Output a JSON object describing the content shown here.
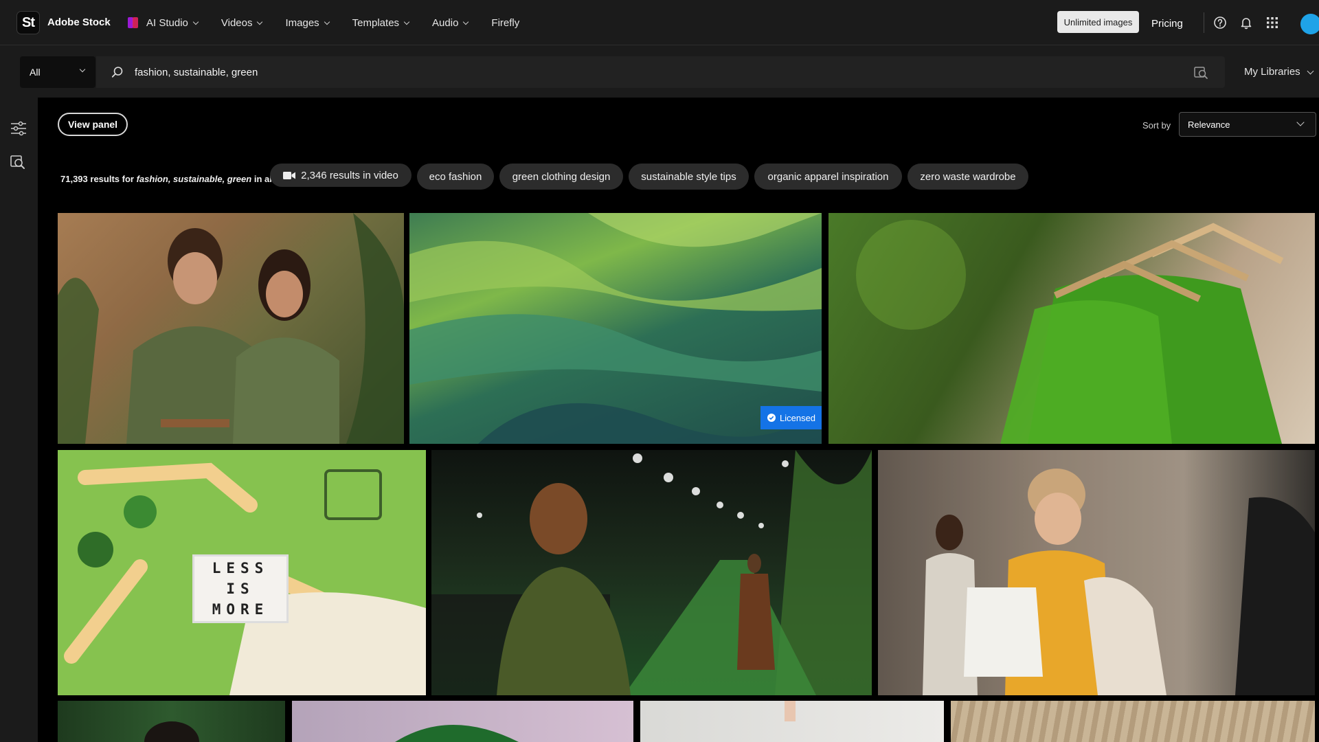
{
  "app": {
    "logo_text": "St",
    "brand": "Adobe Stock"
  },
  "nav": {
    "items": [
      {
        "label": "AI Studio",
        "has_menu": true
      },
      {
        "label": "Videos",
        "has_menu": true
      },
      {
        "label": "Images",
        "has_menu": true
      },
      {
        "label": "Templates",
        "has_menu": true
      },
      {
        "label": "Audio",
        "has_menu": true
      },
      {
        "label": "Firefly",
        "has_menu": false
      }
    ],
    "unlimited_button": "Unlimited images",
    "pricing": "Pricing",
    "icons": [
      "help-icon",
      "bell-icon",
      "apps-grid-icon"
    ]
  },
  "search": {
    "scope": "All",
    "query": "fashion, sustainable, green",
    "my_libraries": "My Libraries"
  },
  "toolbar": {
    "view_panel": "View panel",
    "sort_label": "Sort by",
    "sort_value": "Relevance"
  },
  "results": {
    "count": "71,393",
    "for_text": "results for",
    "query": "fashion, sustainable, green",
    "in_text": "in all",
    "video_results": "2,346 results in video"
  },
  "chips": [
    "eco fashion",
    "green clothing design",
    "sustainable style tips",
    "organic apparel inspiration",
    "zero waste wardrobe"
  ],
  "tiles": {
    "licensed_label": "Licensed",
    "letterboard": [
      "LESS",
      "IS",
      "MORE"
    ]
  },
  "colors": {
    "accent": "#1473e6",
    "avatar": "#1fa3e8"
  }
}
